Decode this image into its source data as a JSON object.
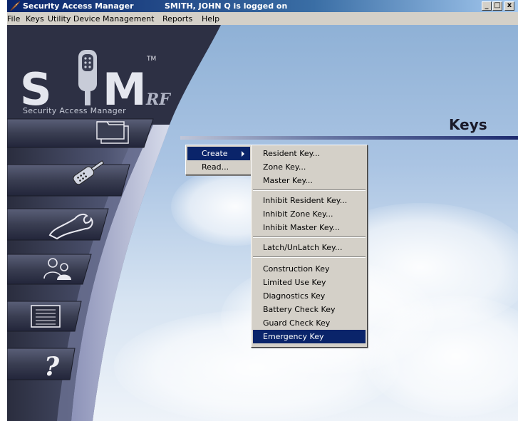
{
  "window": {
    "app_name": "Security Access Manager",
    "logged_on": "SMITH, JOHN Q is logged on",
    "buttons": {
      "minimize": "_",
      "maximize": "□",
      "close": "x"
    }
  },
  "menubar": [
    "File",
    "Keys",
    "Utility Device",
    "Management",
    "Reports",
    "Help"
  ],
  "logo": {
    "tagline": "Security Access Manager",
    "tm": "TM"
  },
  "sidebar": {
    "buttons": [
      {
        "name": "folders",
        "icon": "folders-icon"
      },
      {
        "name": "keys",
        "icon": "key-icon"
      },
      {
        "name": "utility-device",
        "icon": "wrench-icon"
      },
      {
        "name": "management",
        "icon": "users-icon"
      },
      {
        "name": "reports",
        "icon": "report-icon"
      },
      {
        "name": "help",
        "icon": "question-icon",
        "glyph": "?"
      }
    ]
  },
  "main": {
    "heading": "Keys"
  },
  "keys_menu": {
    "create": "Create",
    "read": "Read..."
  },
  "create_submenu": {
    "group1": [
      "Resident Key...",
      "Zone Key...",
      "Master Key..."
    ],
    "group2": [
      "Inhibit Resident Key...",
      "Inhibit Zone Key...",
      "Inhibit Master Key..."
    ],
    "group3": [
      "Latch/UnLatch Key..."
    ],
    "group4": [
      "Construction Key",
      "Limited Use Key",
      "Diagnostics Key",
      "Battery Check Key",
      "Guard Check Key",
      "Emergency Key"
    ],
    "highlighted": "Emergency Key"
  },
  "colors": {
    "title_bar": "#0a246a",
    "highlight": "#0a246a",
    "menu_bg": "#d4d0c8",
    "sidebar": "#3a3f55"
  }
}
